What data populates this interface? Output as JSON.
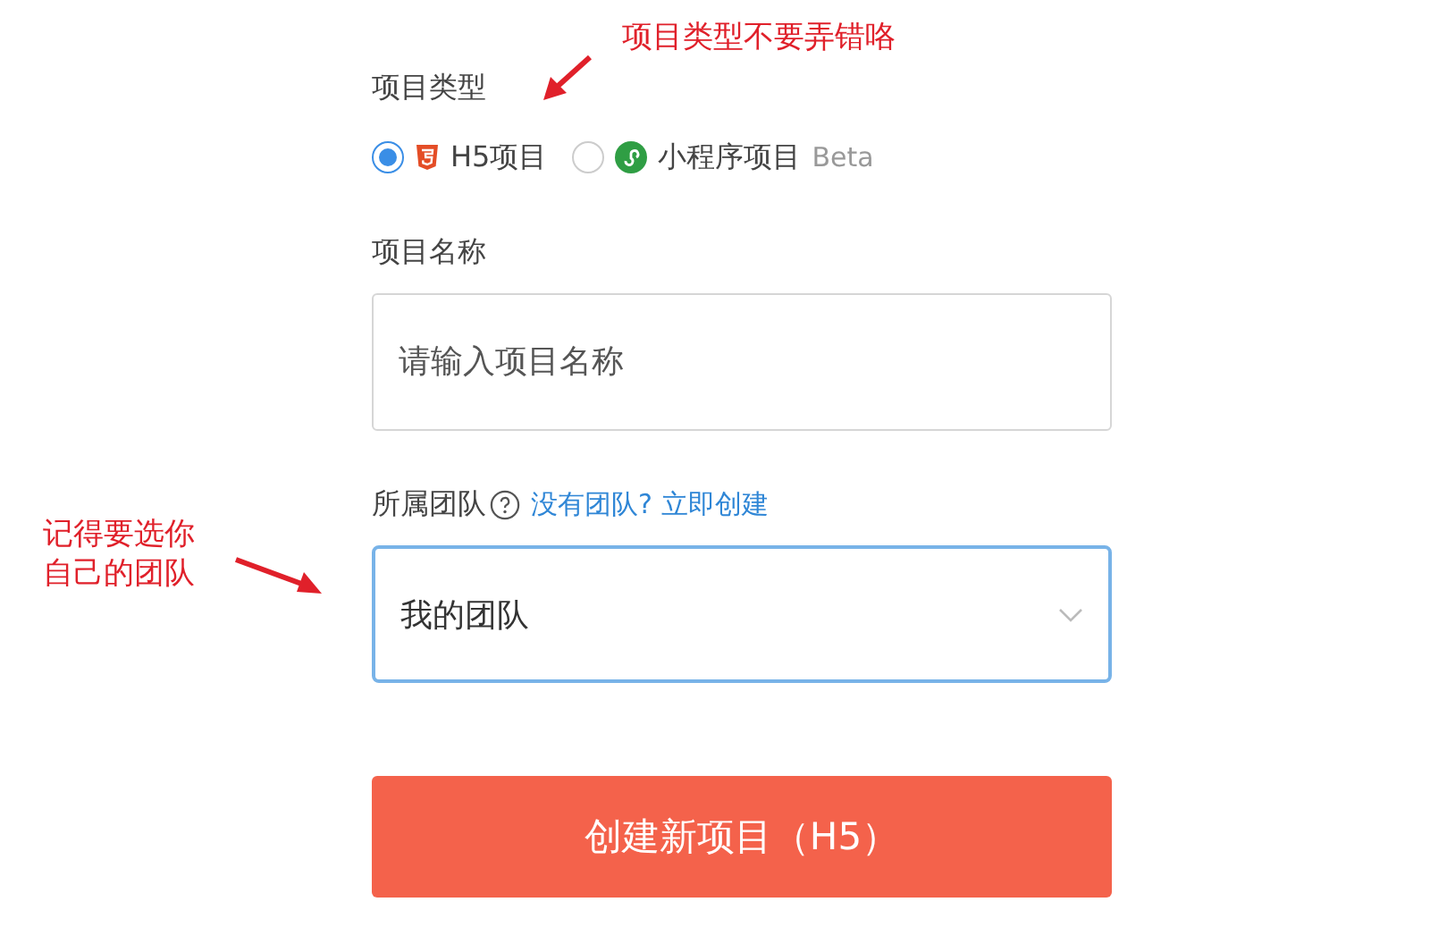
{
  "project_type": {
    "label": "项目类型",
    "options": [
      {
        "kind": "h5",
        "label": "H5项目",
        "selected": true
      },
      {
        "kind": "miniprogram",
        "label": "小程序项目",
        "badge": "Beta",
        "selected": false
      }
    ]
  },
  "project_name": {
    "label": "项目名称",
    "placeholder": "请输入项目名称"
  },
  "team": {
    "label": "所属团队",
    "hint": "没有团队?",
    "link": "立即创建",
    "value": "我的团队"
  },
  "submit_button": "创建新项目（H5）",
  "annotations": [
    {
      "text": "项目类型不要弄错咯",
      "kind": "left"
    },
    {
      "text": "记得要选你自己的团队",
      "kind": "right"
    }
  ]
}
